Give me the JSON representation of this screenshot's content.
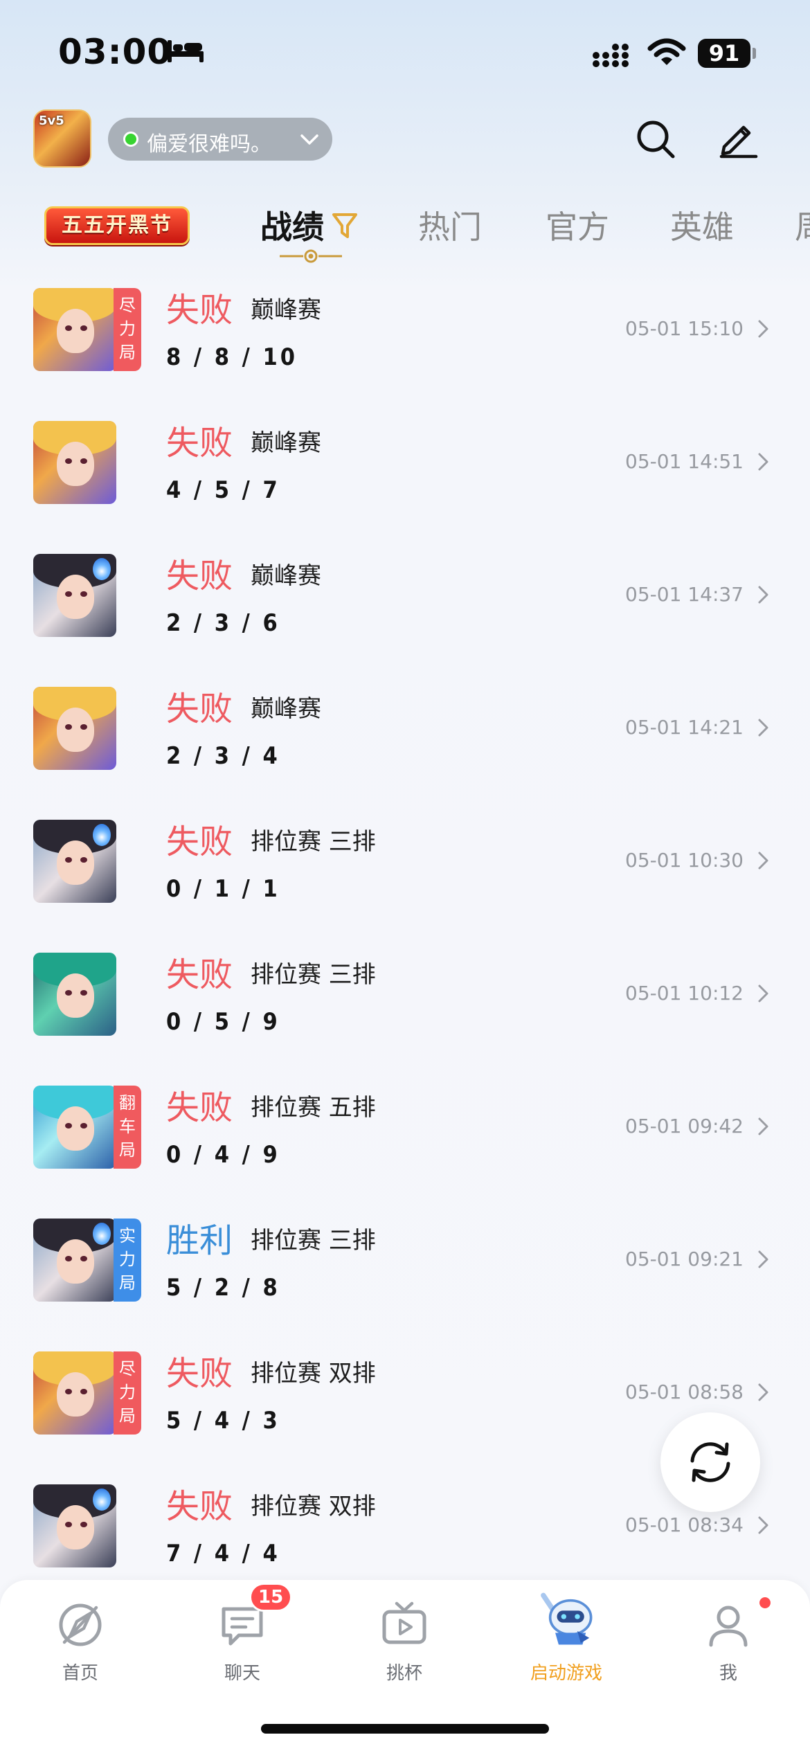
{
  "status_bar": {
    "time": "03:00",
    "battery": "91"
  },
  "header": {
    "account_name": "偏爱很难吗。",
    "app_badge": "5v5"
  },
  "tabs": {
    "festival": "五五开黑节",
    "items": [
      {
        "label": "战绩",
        "active": true
      },
      {
        "label": "热门",
        "active": false
      },
      {
        "label": "官方",
        "active": false
      },
      {
        "label": "英雄",
        "active": false
      },
      {
        "label": "周",
        "active": false
      }
    ]
  },
  "matches": [
    {
      "result": "失败",
      "outcome": "lose",
      "mode": "巅峰赛",
      "kda": "8 / 8 / 10",
      "time": "05-01 15:10",
      "tag": "尽力局",
      "tag_color": "red",
      "hero": "blonde"
    },
    {
      "result": "失败",
      "outcome": "lose",
      "mode": "巅峰赛",
      "kda": "4 / 5 / 7",
      "time": "05-01 14:51",
      "tag": "",
      "tag_color": "",
      "hero": "blonde"
    },
    {
      "result": "失败",
      "outcome": "lose",
      "mode": "巅峰赛",
      "kda": "2 / 3 / 6",
      "time": "05-01 14:37",
      "tag": "",
      "tag_color": "",
      "hero": "dark"
    },
    {
      "result": "失败",
      "outcome": "lose",
      "mode": "巅峰赛",
      "kda": "2 / 3 / 4",
      "time": "05-01 14:21",
      "tag": "",
      "tag_color": "",
      "hero": "blonde"
    },
    {
      "result": "失败",
      "outcome": "lose",
      "mode": "排位赛 三排",
      "kda": "0 / 1 / 1",
      "time": "05-01 10:30",
      "tag": "",
      "tag_color": "",
      "hero": "dark"
    },
    {
      "result": "失败",
      "outcome": "lose",
      "mode": "排位赛 三排",
      "kda": "0 / 5 / 9",
      "time": "05-01 10:12",
      "tag": "",
      "tag_color": "",
      "hero": "green"
    },
    {
      "result": "失败",
      "outcome": "lose",
      "mode": "排位赛 五排",
      "kda": "0 / 4 / 9",
      "time": "05-01 09:42",
      "tag": "翻车局",
      "tag_color": "red",
      "hero": "cyan"
    },
    {
      "result": "胜利",
      "outcome": "win",
      "mode": "排位赛 三排",
      "kda": "5 / 2 / 8",
      "time": "05-01 09:21",
      "tag": "实力局",
      "tag_color": "blue",
      "hero": "dark"
    },
    {
      "result": "失败",
      "outcome": "lose",
      "mode": "排位赛 双排",
      "kda": "5 / 4 / 3",
      "time": "05-01 08:58",
      "tag": "尽力局",
      "tag_color": "red",
      "hero": "blonde"
    },
    {
      "result": "失败",
      "outcome": "lose",
      "mode": "排位赛 双排",
      "kda": "7 / 4 / 4",
      "time": "05-01 08:34",
      "tag": "",
      "tag_color": "",
      "hero": "dark"
    }
  ],
  "bottom_nav": [
    {
      "label": "首页",
      "icon": "compass-icon",
      "active": false,
      "badge": ""
    },
    {
      "label": "聊天",
      "icon": "chat-icon",
      "active": false,
      "badge": "15"
    },
    {
      "label": "挑杯",
      "icon": "tv-icon",
      "active": false,
      "badge": ""
    },
    {
      "label": "启动游戏",
      "icon": "robot-mascot-icon",
      "active": true,
      "badge": ""
    },
    {
      "label": "我",
      "icon": "person-icon",
      "active": false,
      "badge": "dot"
    }
  ],
  "colors": {
    "lose": "#ee5a60",
    "win": "#3a8ed8",
    "active_nav": "#f1a020",
    "tag_red": "#f05a5e",
    "tag_blue": "#3e8ee8"
  }
}
